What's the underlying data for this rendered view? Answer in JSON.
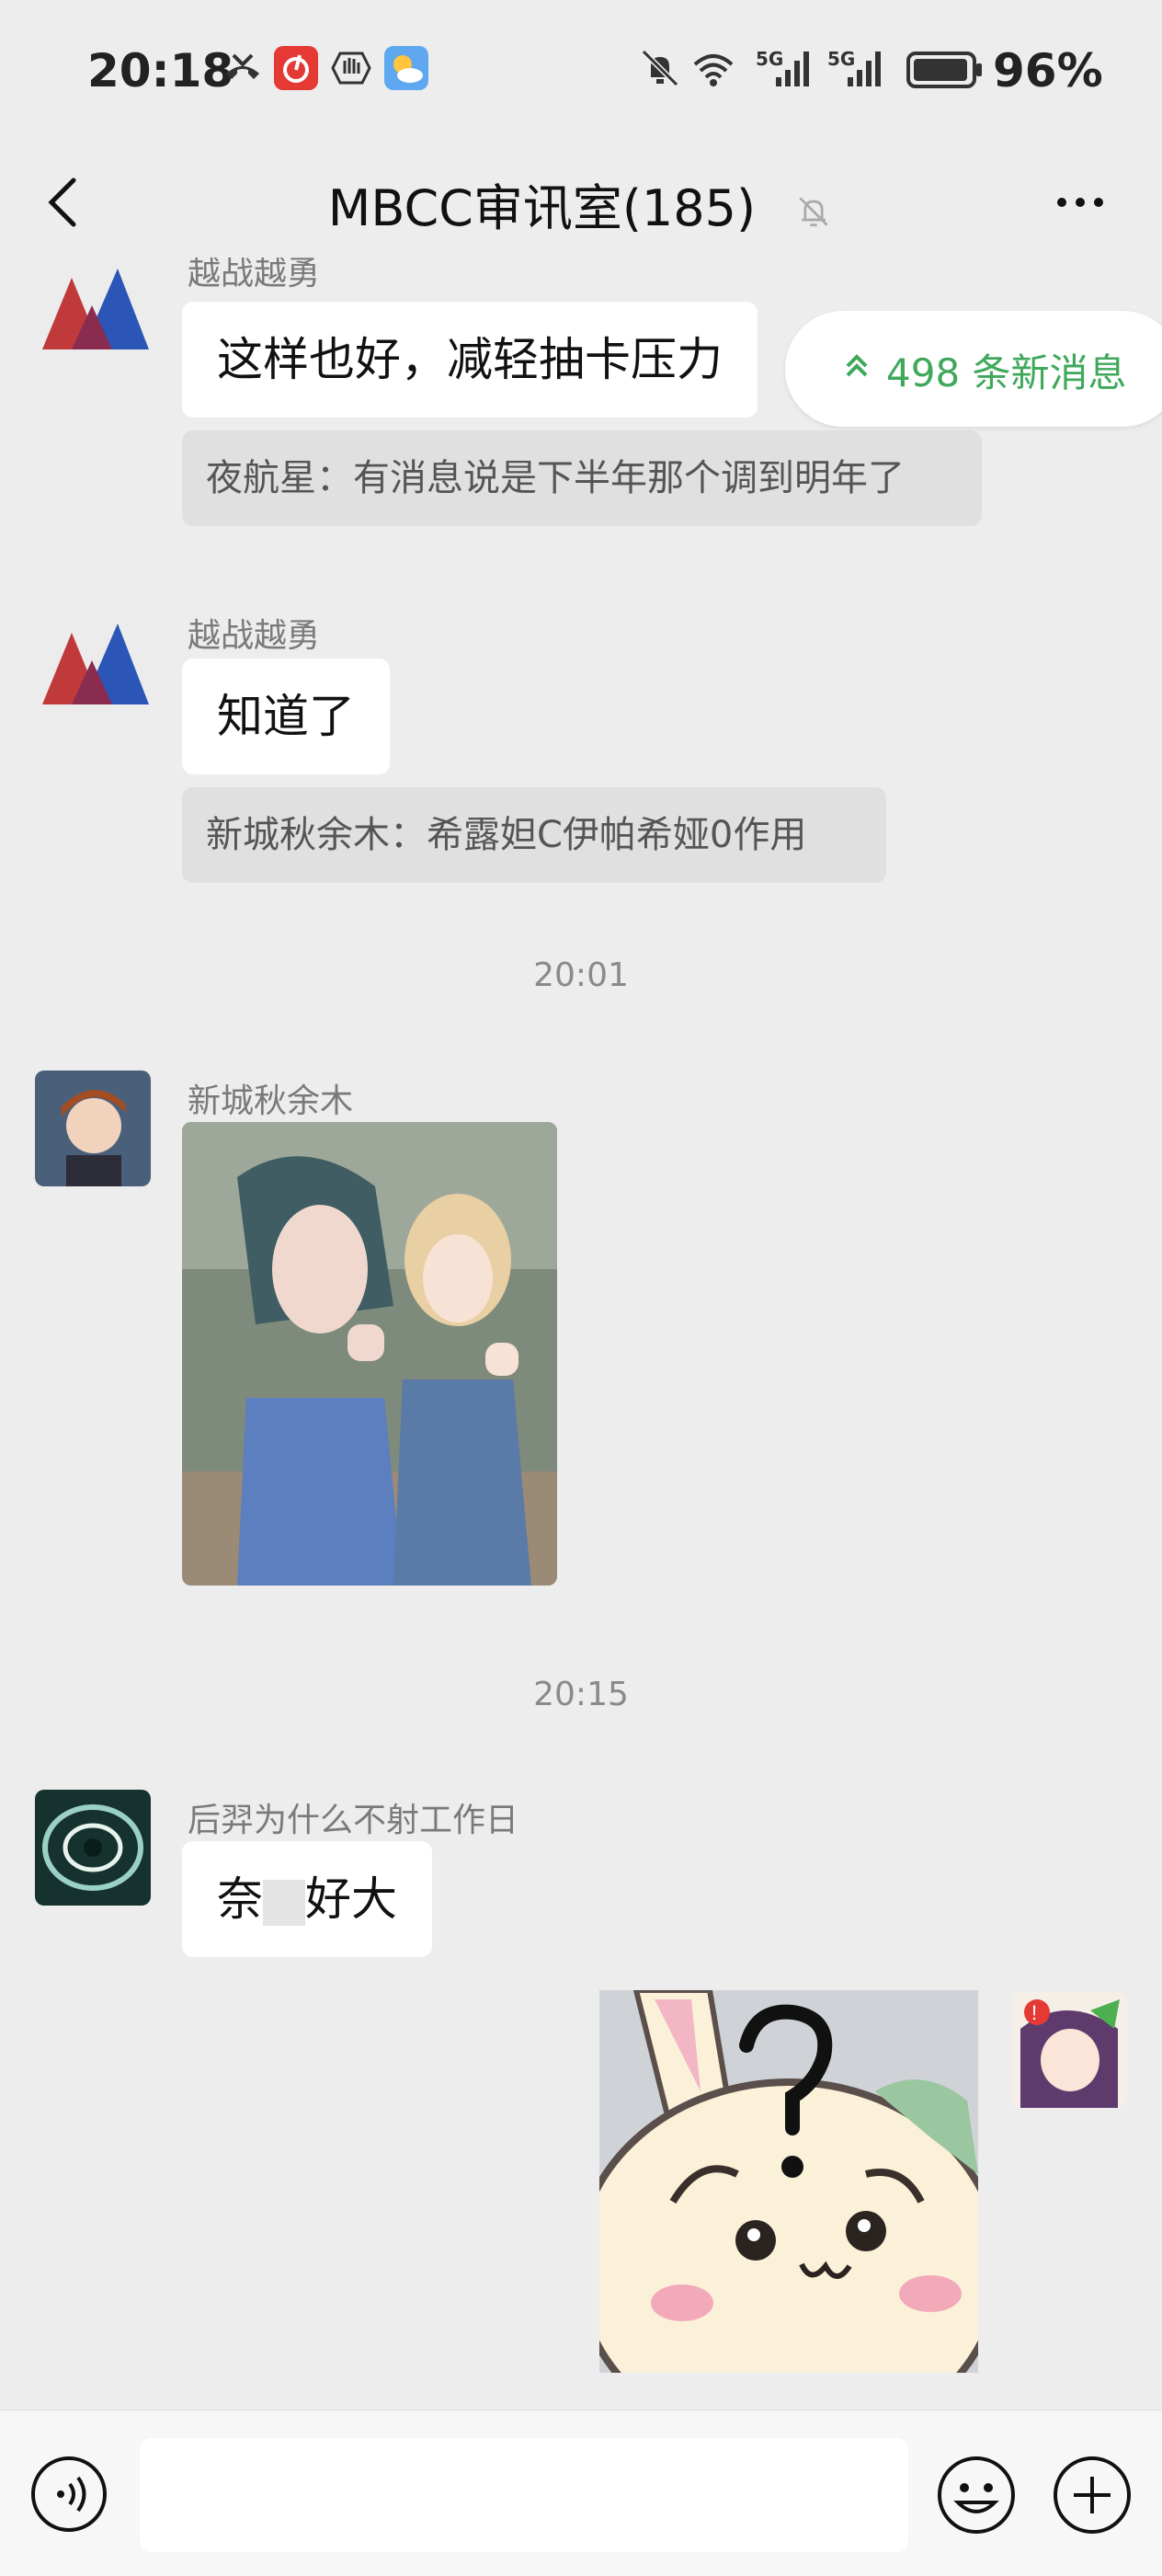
{
  "status_bar": {
    "time": "20:18",
    "battery": "96%",
    "net1": "5G",
    "net2": "5G"
  },
  "nav": {
    "title": "MBCC审讯室(185)"
  },
  "new_messages": {
    "label": "498 条新消息"
  },
  "messages": {
    "m1": {
      "sender": "越战越勇",
      "text": "这样也好，减轻抽卡压力",
      "quote": "夜航星：有消息说是下半年那个调到明年了"
    },
    "m2": {
      "sender": "越战越勇",
      "text": "知道了",
      "quote": "新城秋余木：希露妲C伊帕希娅0作用"
    },
    "ts1": "20:01",
    "m3": {
      "sender": "新城秋余木"
    },
    "ts2": "20:15",
    "m4": {
      "sender": "后羿为什么不射工作日",
      "text_part1": "奈",
      "text_part2": "好大"
    }
  },
  "input": {
    "placeholder": ""
  },
  "colors": {
    "accent_green": "#3fa85b",
    "background": "#ededed"
  }
}
